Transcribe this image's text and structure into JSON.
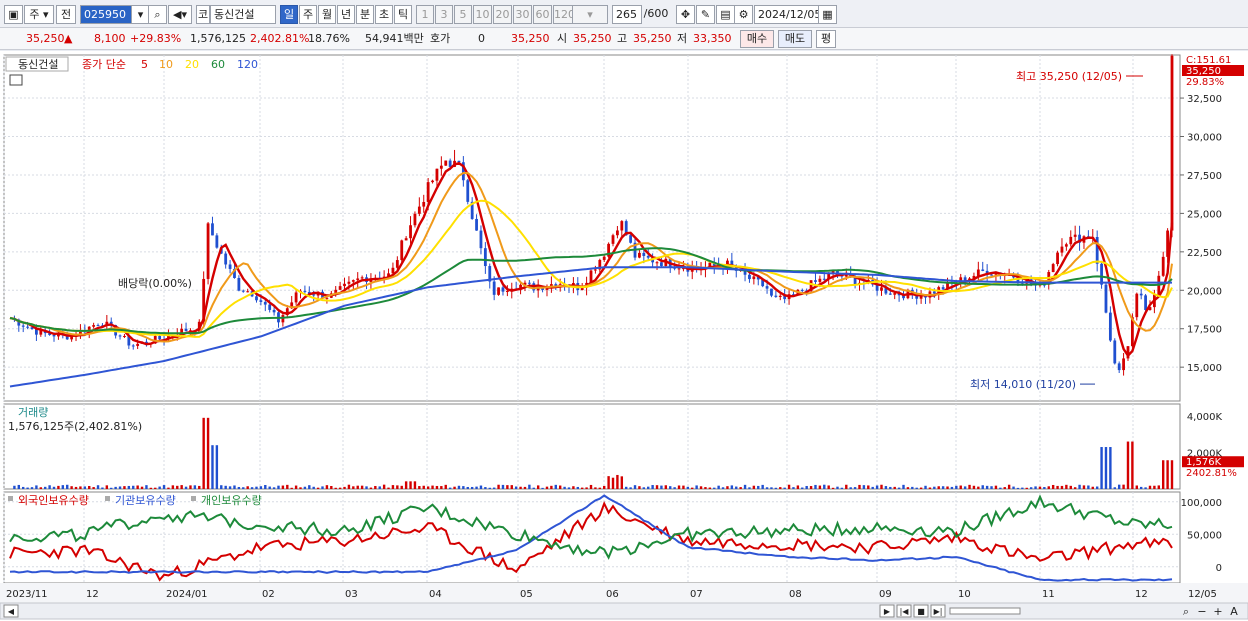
{
  "toolbar": {
    "market": "주",
    "sub": "전",
    "code": "025950",
    "market_label": "코",
    "name": "동신건설",
    "periods": [
      "일",
      "주",
      "월",
      "년",
      "분",
      "초",
      "틱"
    ],
    "active_period": "일",
    "intervals": [
      "1",
      "3",
      "5",
      "10",
      "20",
      "30",
      "60",
      "120"
    ],
    "count": "265",
    "count_max": "/600",
    "date": "2024/12/05"
  },
  "pricebar": {
    "price": "35,250",
    "change": "8,100",
    "change_pct": "+29.83%",
    "volume": "1,576,125",
    "volume_pct": "2,402.81%",
    "turnover": "18.76%",
    "amount": "54,941백만",
    "hoga_label": "호가",
    "hoga_value": "0",
    "hoga_price": "35,250",
    "open_label": "시",
    "open": "35,250",
    "high_label": "고",
    "high": "35,250",
    "low_label": "저",
    "low": "33,350",
    "buy": "매수",
    "sell": "매도",
    "eval": "평"
  },
  "price_panel": {
    "stock_label": "동신건설",
    "ma_label": "종가 단순",
    "ma_periods": [
      "5",
      "10",
      "20",
      "60",
      "120"
    ],
    "ma_colors": [
      "#d40000",
      "#f09a1a",
      "#ffe000",
      "#1d8a3a",
      "#2f55d4"
    ],
    "max_label": "최고 35,250 (12/05)",
    "min_label": "최저 14,010 (11/20)",
    "dividend_label": "배당락(0.00%)",
    "cur_label": "35,250",
    "cur_pct": "29.83%",
    "c_label": "C:151.61"
  },
  "volume_panel": {
    "title": "거래량",
    "info": "1,576,125주(2,402.81%)",
    "cur_label": "1,576K",
    "cur_pct": "2402.81%"
  },
  "holdings_panel": {
    "series_labels": [
      "외국인보유수량",
      "기관보유수량",
      "개인보유수량"
    ],
    "series_colors": [
      "#d40000",
      "#2f55d4",
      "#1d8a3a"
    ]
  },
  "chart_data": {
    "type": "line",
    "title": "동신건설",
    "x_ticks": [
      "2023/11",
      "12",
      "2024/01",
      "02",
      "03",
      "04",
      "05",
      "06",
      "07",
      "08",
      "09",
      "10",
      "11",
      "12",
      "12/05"
    ],
    "price_y_ticks": [
      15000,
      17500,
      20000,
      22500,
      25000,
      27500,
      30000,
      32500
    ],
    "price_ylim": [
      12800,
      35300
    ],
    "volume_y_ticks": [
      "4,000K",
      "2,000K"
    ],
    "volume_ylim": [
      0,
      4000000
    ],
    "holdings_y_ticks": [
      100000,
      50000,
      0
    ],
    "holdings_ylim": [
      -25000,
      115000
    ],
    "months": [
      "2023/11",
      "12",
      "2024/01",
      "02",
      "03",
      "04",
      "05",
      "06",
      "07",
      "08",
      "09",
      "10",
      "11",
      "12"
    ],
    "close_monthly": [
      17500,
      16400,
      20300,
      18800,
      21400,
      27800,
      20500,
      22000,
      21500,
      19600,
      19700,
      20500,
      16500,
      35250
    ],
    "ma120_monthly": [
      13700,
      14500,
      15400,
      17000,
      19000,
      20200,
      20900,
      21500,
      21500,
      21200,
      21000,
      20600,
      20500,
      20500
    ],
    "volume_max": 3900000,
    "holdings": [
      {
        "name": "외국인보유수량",
        "values": [
          20000,
          25000,
          -15000,
          30000,
          40000,
          60000,
          -5000,
          90000,
          40000,
          35000,
          30000,
          45000,
          10000,
          35000
        ]
      },
      {
        "name": "기관보유수량",
        "values": [
          -8000,
          -8000,
          -8000,
          -8000,
          -8000,
          -8000,
          25000,
          110000,
          30000,
          15000,
          10000,
          15000,
          -20000,
          -20000
        ]
      },
      {
        "name": "개인보유수량",
        "values": [
          45000,
          50000,
          80000,
          65000,
          55000,
          90000,
          50000,
          20000,
          50000,
          55000,
          60000,
          55000,
          100000,
          65000
        ]
      }
    ]
  }
}
